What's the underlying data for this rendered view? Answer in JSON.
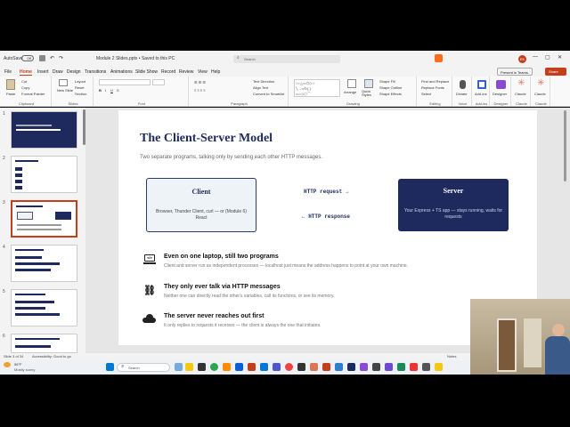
{
  "titlebar": {
    "autosave": "AutoSave",
    "toggle": "Off",
    "doc_title": "Module 2 Slides.pptx • Saved to this PC",
    "search": "Search",
    "present_teams": "Present in Teams",
    "share": "Share"
  },
  "menu": [
    "File",
    "Home",
    "Insert",
    "Draw",
    "Design",
    "Transitions",
    "Animations",
    "Slide Show",
    "Record",
    "Review",
    "View",
    "Help"
  ],
  "ribbon": {
    "clipboard": {
      "label": "Clipboard",
      "paste": "Paste",
      "cut": "Cut",
      "copy": "Copy",
      "format_painter": "Format Painter"
    },
    "slides": {
      "label": "Slides",
      "new_slide": "New Slide",
      "layout": "Layout",
      "reset": "Reset",
      "section": "Section"
    },
    "font": {
      "label": "Font"
    },
    "paragraph": {
      "label": "Paragraph",
      "text_direction": "Text Direction",
      "align_text": "Align Text",
      "smartart": "Convert to SmartArt"
    },
    "drawing": {
      "label": "Drawing",
      "arrange": "Arrange",
      "quick_styles": "Quick Styles",
      "shape_fill": "Shape Fill",
      "shape_outline": "Shape Outline",
      "shape_effects": "Shape Effects"
    },
    "editing": {
      "label": "Editing",
      "find_replace": "Find and Replace",
      "replace_fonts": "Replace Fonts",
      "select": "Select"
    },
    "voice": {
      "label": "Voice",
      "dictate": "Dictate"
    },
    "addins": {
      "label": "Add-ins",
      "addins_btn": "Add-ins"
    },
    "designer": {
      "label": "Designer",
      "btn": "Designer"
    },
    "claude1": {
      "label": "Claude",
      "btn": "Claude"
    },
    "claude2": {
      "label": "Claude",
      "btn": "Claude"
    }
  },
  "thumbnails": [
    "1",
    "2",
    "3",
    "4",
    "5",
    "6"
  ],
  "slide": {
    "title": "The Client-Server Model",
    "subtitle": "Two separate programs, talking only by sending each other HTTP messages.",
    "client_title": "Client",
    "client_desc": "Browser, Thunder Client, curl — or (Module 6) React",
    "http_request": "HTTP request  →",
    "http_response": "←  HTTP response",
    "server_title": "Server",
    "server_desc": "Your Express + TS app — stays running, waits for requests",
    "points": [
      {
        "heading": "Even on one laptop, still two programs",
        "text": "Client and server run as independent processes — localhost just means the address happens to point at your own machine."
      },
      {
        "heading": "They only ever talk via HTTP messages",
        "text": "Neither one can directly read the other's variables, call its functions, or see its memory."
      },
      {
        "heading": "The server never reaches out first",
        "text": "It only replies to requests it receives — the client is always the one that initiates."
      }
    ]
  },
  "statusbar": {
    "slide_info": "Slide 3 of 34",
    "accessibility": "Accessibility: Good to go",
    "notes": "Notes"
  },
  "taskbar": {
    "temp": "56°F",
    "weather": "Mostly sunny",
    "search": "Search"
  },
  "colors": {
    "navy": "#1e2a5e",
    "client_bg": "#eef3f8",
    "accent": "#c43e1c"
  }
}
